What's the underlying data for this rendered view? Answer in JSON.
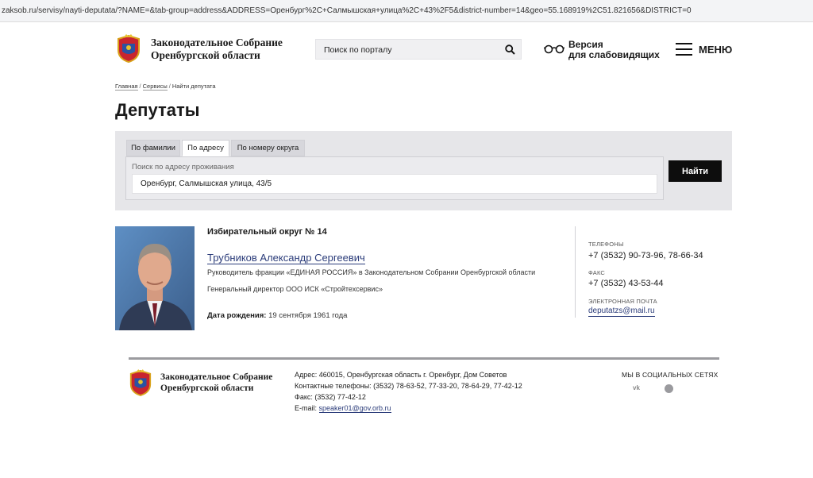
{
  "browser": {
    "url": "zaksob.ru/servisy/nayti-deputata/?NAME=&tab-group=address&ADDRESS=Оренбург%2C+Салмышская+улица%2C+43%2F5&district-number=14&geo=55.168919%2C51.821656&DISTRICT=0"
  },
  "header": {
    "title_line1": "Законодательное Собрание",
    "title_line2": "Оренбургской области",
    "search_placeholder": "Поиск по порталу",
    "vision_line1": "Версия",
    "vision_line2": "для слабовидящих",
    "menu_label": "МЕНЮ"
  },
  "breadcrumb": {
    "items": [
      "Главная",
      "Сервисы",
      "Найти депутата"
    ]
  },
  "page_title": "Депутаты",
  "search_form": {
    "tabs": [
      "По фамилии",
      "По адресу",
      "По номеру округа"
    ],
    "active_tab": "По адресу",
    "address_label": "Поиск по адресу проживания",
    "address_value": "Оренбург, Салмышская улица, 43/5",
    "submit_label": "Найти"
  },
  "deputy": {
    "district": "Избирательный округ № 14",
    "name": "Трубников Александр Сергеевич",
    "role": "Руководитель фракции «ЕДИНАЯ РОССИЯ» в Законодательном Собрании Оренбургской области",
    "job": "Генеральный директор ООО ИСК «Стройтехсервис»",
    "birth_label": "Дата рождения:",
    "birth_value": "19 сентября 1961 года"
  },
  "contacts": {
    "phones_label": "ТЕЛЕФОНЫ",
    "phones_value": "+7 (3532) 90-73-96, 78-66-34",
    "fax_label": "ФАКС",
    "fax_value": "+7 (3532) 43-53-44",
    "email_label": "ЭЛЕКТРОННАЯ ПОЧТА",
    "email_value": "deputatzs@mail.ru"
  },
  "footer": {
    "title_line1": "Законодательное Собрание",
    "title_line2": "Оренбургской области",
    "address": "Адрес: 460015, Оренбургская область г. Оренбург, Дом Советов",
    "phones": "Контактные телефоны: (3532) 78-63-52, 77-33-20, 78-64-29, 77-42-12",
    "fax": "Факс: (3532) 77-42-12",
    "email_label": "E-mail:",
    "email": "speaker01@gov.orb.ru",
    "social_title": "МЫ В СОЦИАЛЬНЫХ СЕТЯХ",
    "vk_label": "vk"
  },
  "colors": {
    "link": "#2b3c7a",
    "panel_bg": "#e6e6e9",
    "button_bg": "#0d0d0d"
  }
}
